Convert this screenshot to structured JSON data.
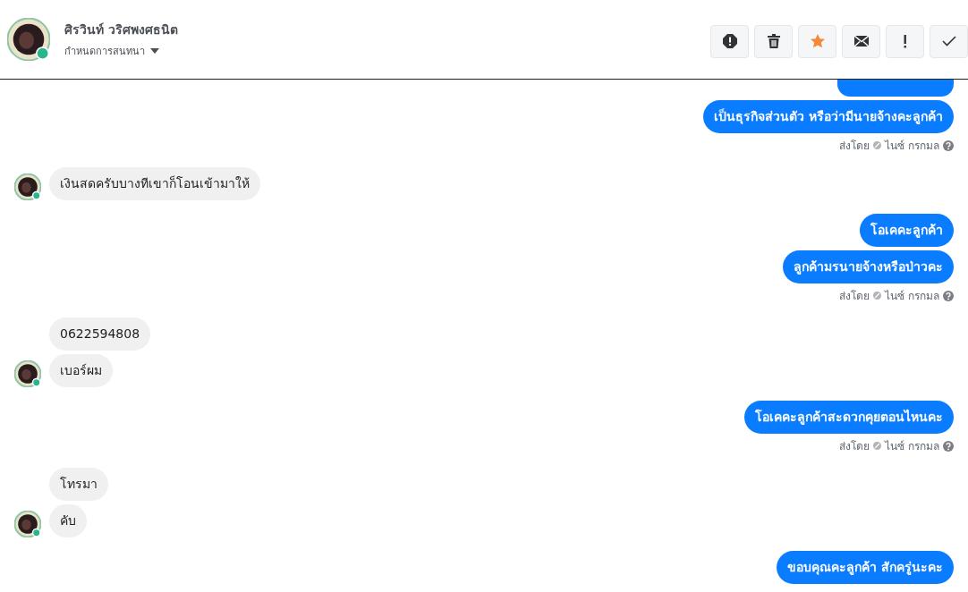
{
  "header": {
    "name": "ศิรวินท์ วริศพงศธนิต",
    "subtitle": "กำหนดการสนทนา"
  },
  "actions": [
    {
      "kind": "alert"
    },
    {
      "kind": "trash"
    },
    {
      "kind": "star"
    },
    {
      "kind": "mail"
    },
    {
      "kind": "bang"
    },
    {
      "kind": "check"
    }
  ],
  "groups": [
    {
      "kind": "outgoing",
      "messages": [
        {
          "kind": "cut"
        },
        {
          "text": "เป็นธุรกิจส่วนตัว หรือว่ามีนายจ้างคะลูกค้า"
        }
      ],
      "sent_by": "ส่งโดย",
      "sender": "ไนซ์ กรกมล"
    },
    {
      "kind": "incoming",
      "messages": [
        {
          "text": "เงินสดครับบางทีเขาก็โอนเข้ามาให้"
        }
      ]
    },
    {
      "kind": "outgoing",
      "messages": [
        {
          "text": "โอเคคะลูกค้า"
        },
        {
          "text": "ลูกค้ามรนายจ้างหรือป่าวคะ"
        }
      ],
      "sent_by": "ส่งโดย",
      "sender": "ไนซ์ กรกมล"
    },
    {
      "kind": "incoming",
      "messages": [
        {
          "text": "0622594808"
        },
        {
          "text": "เบอร์ผม"
        }
      ]
    },
    {
      "kind": "outgoing",
      "messages": [
        {
          "text": "โอเคคะลูกค้าสะดวกคุยตอนไหนคะ"
        }
      ],
      "sent_by": "ส่งโดย",
      "sender": "ไนซ์ กรกมล"
    },
    {
      "kind": "incoming",
      "messages": [
        {
          "text": "โทรมา"
        },
        {
          "text": "คับ"
        }
      ]
    },
    {
      "kind": "outgoing",
      "messages": [
        {
          "text": "ขอบคุณคะลูกค้า สักครู่นะคะ"
        }
      ]
    }
  ]
}
